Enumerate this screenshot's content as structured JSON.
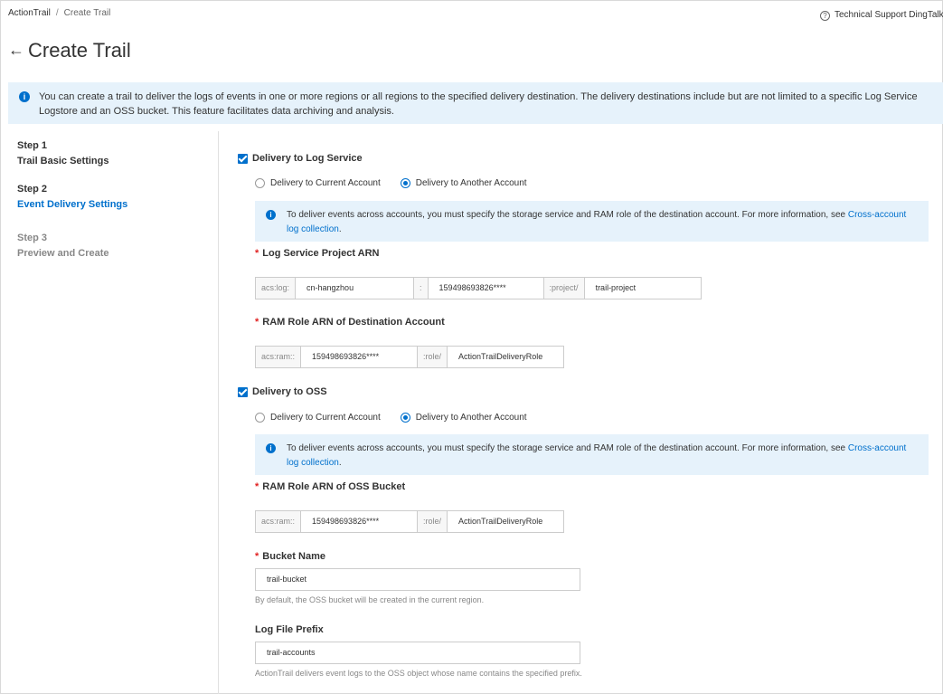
{
  "breadcrumb": {
    "root": "ActionTrail",
    "separator": "/",
    "current": "Create Trail"
  },
  "support": {
    "icon": "question-circle-icon",
    "text": "Technical Support DingTalk C"
  },
  "header": {
    "back_icon": "arrow-left-icon",
    "title": "Create Trail"
  },
  "notice": {
    "icon": "info-icon",
    "text": "You can create a trail to deliver the logs of events in one or more regions or all regions to the specified delivery destination. The delivery destinations include but are not limited to a specific Log Service Logstore and an OSS bucket. This feature facilitates data archiving and analysis."
  },
  "steps": [
    {
      "num": "Step 1",
      "name": "Trail Basic Settings",
      "state": "done"
    },
    {
      "num": "Step 2",
      "name": "Event Delivery Settings",
      "state": "active"
    },
    {
      "num": "Step 3",
      "name": "Preview and Create",
      "state": "disabled"
    }
  ],
  "log_service": {
    "checkbox_label": "Delivery to Log Service",
    "checked": true,
    "radio_current": "Delivery to Current Account",
    "radio_another": "Delivery to Another Account",
    "selected": "another",
    "tip_text": "To deliver events across accounts, you must specify the storage service and RAM role of the destination account. For more information, see ",
    "tip_link": "Cross-account log collection",
    "tip_end": ".",
    "project_label": "Log Service Project ARN",
    "project_arn": {
      "prefix": "acs:log:",
      "region": "cn-hangzhou",
      "colon": ":",
      "account": "159498693826****",
      "project_prefix": ":project/",
      "project": "trail-project"
    },
    "role_label": "RAM Role ARN of Destination Account",
    "role_arn": {
      "prefix": "acs:ram::",
      "account": "159498693826****",
      "role_prefix": ":role/",
      "role": "ActionTrailDeliveryRole"
    }
  },
  "oss": {
    "checkbox_label": "Delivery to OSS",
    "checked": true,
    "radio_current": "Delivery to Current Account",
    "radio_another": "Delivery to Another Account",
    "selected": "another",
    "tip_text": "To deliver events across accounts, you must specify the storage service and RAM role of the destination account. For more information, see ",
    "tip_link": "Cross-account log collection",
    "tip_end": ".",
    "role_label": "RAM Role ARN of OSS Bucket",
    "role_arn": {
      "prefix": "acs:ram::",
      "account": "159498693826****",
      "role_prefix": ":role/",
      "role": "ActionTrailDeliveryRole"
    },
    "bucket_label": "Bucket Name",
    "bucket_value": "trail-bucket",
    "bucket_help": "By default, the OSS bucket will be created in the current region.",
    "prefix_label": "Log File Prefix",
    "prefix_value": "trail-accounts",
    "prefix_help": "ActionTrail delivers event logs to the OSS object whose name contains the specified prefix."
  },
  "required_mark": "*",
  "colors": {
    "accent": "#0070cc",
    "notice_bg": "#e6f2fb",
    "required": "#e02020"
  }
}
